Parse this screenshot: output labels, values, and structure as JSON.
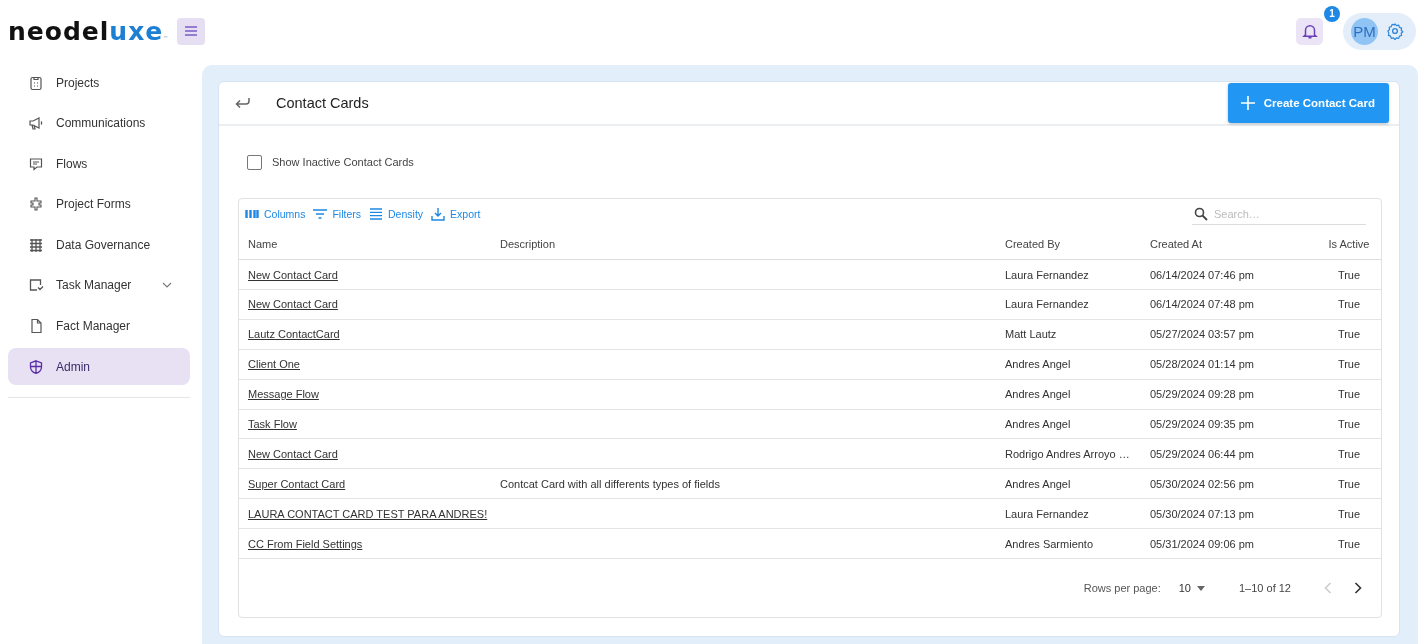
{
  "header": {
    "logo": {
      "dark": "neodel",
      "accent": "uxe",
      "mark": "™"
    },
    "notifications": {
      "count": "1"
    },
    "user": {
      "initials": "PM"
    }
  },
  "sidebar": {
    "items": [
      {
        "kind": "projects",
        "label": "Projects",
        "selected": false
      },
      {
        "kind": "communications",
        "label": "Communications",
        "selected": false
      },
      {
        "kind": "flows",
        "label": "Flows",
        "selected": false
      },
      {
        "kind": "forms",
        "label": "Project Forms",
        "selected": false
      },
      {
        "kind": "governance",
        "label": "Data Governance",
        "selected": false
      },
      {
        "kind": "tasks",
        "label": "Task Manager",
        "selected": false,
        "expanded": false
      },
      {
        "kind": "facts",
        "label": "Fact Manager",
        "selected": false
      },
      {
        "kind": "admin",
        "label": "Admin",
        "selected": true
      }
    ]
  },
  "page": {
    "title": "Contact Cards",
    "create_button": "Create Contact Card",
    "show_inactive": {
      "label": "Show Inactive Contact Cards",
      "checked": false
    }
  },
  "toolbar": [
    {
      "kind": "columns",
      "label": "Columns"
    },
    {
      "kind": "filters",
      "label": "Filters"
    },
    {
      "kind": "density",
      "label": "Density"
    },
    {
      "kind": "export",
      "label": "Export"
    }
  ],
  "search": {
    "placeholder": "Search…"
  },
  "table": {
    "columns": [
      "Name",
      "Description",
      "Created By",
      "Created At",
      "Is Active"
    ],
    "rows": [
      [
        "New Contact Card",
        "",
        "Laura Fernandez",
        "06/14/2024 07:46 pm",
        "True"
      ],
      [
        "New Contact Card",
        "",
        "Laura Fernandez",
        "06/14/2024 07:48 pm",
        "True"
      ],
      [
        "Lautz ContactCard",
        "",
        "Matt Lautz",
        "05/27/2024 03:57 pm",
        "True"
      ],
      [
        "Client One",
        "",
        "Andres Angel",
        "05/28/2024 01:14 pm",
        "True"
      ],
      [
        "Message Flow",
        "",
        "Andres Angel",
        "05/29/2024 09:28 pm",
        "True"
      ],
      [
        "Task Flow",
        "",
        "Andres Angel",
        "05/29/2024 09:35 pm",
        "True"
      ],
      [
        "New Contact Card",
        "",
        "Rodrigo Andres Arroyo …",
        "05/29/2024 06:44 pm",
        "True"
      ],
      [
        "Super Contact Card",
        "Contcat Card with all differents types of fields",
        "Andres Angel",
        "05/30/2024 02:56 pm",
        "True"
      ],
      [
        "LAURA CONTACT CARD TEST PARA ANDRES!",
        "",
        "Laura Fernandez",
        "05/30/2024 07:13 pm",
        "True"
      ],
      [
        "CC From Field Settings",
        "",
        "Andres Sarmiento",
        "05/31/2024 09:06 pm",
        "True"
      ]
    ]
  },
  "pagination": {
    "rows_label": "Rows per page:",
    "rows_value": "10",
    "range": "1–10 of 12",
    "prev_disabled": true,
    "next_disabled": false
  }
}
